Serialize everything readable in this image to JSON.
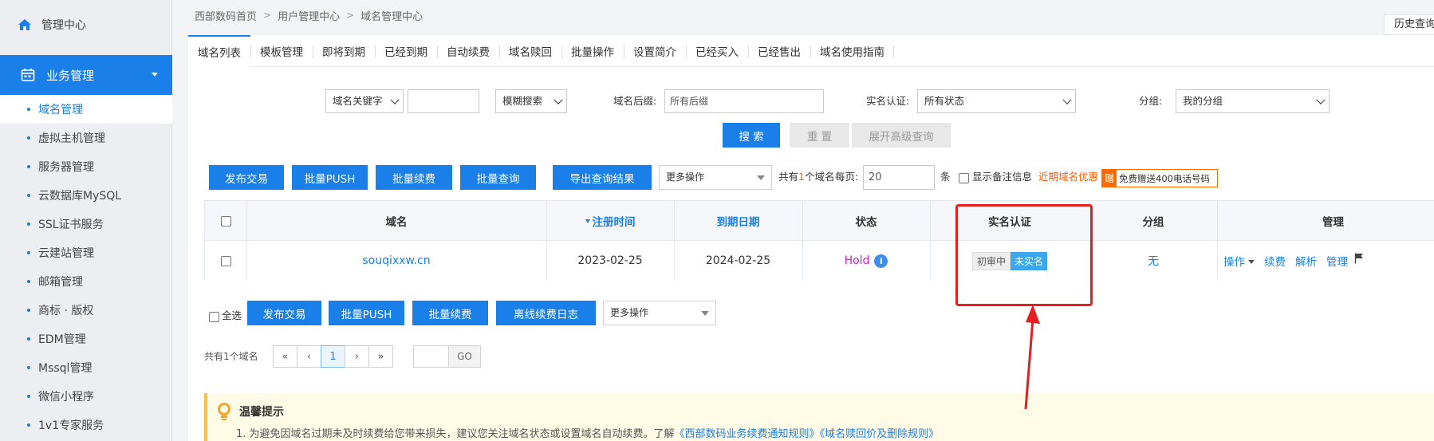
{
  "sidebar": {
    "top_item": "管理中心",
    "section": "业务管理",
    "items": [
      {
        "label": "域名管理",
        "active": true
      },
      {
        "label": "虚拟主机管理"
      },
      {
        "label": "服务器管理"
      },
      {
        "label": "云数据库MySQL"
      },
      {
        "label": "SSL证书服务"
      },
      {
        "label": "云建站管理"
      },
      {
        "label": "邮箱管理"
      },
      {
        "label": "商标 · 版权"
      },
      {
        "label": "EDM管理"
      },
      {
        "label": "Mssql管理"
      },
      {
        "label": "微信小程序"
      },
      {
        "label": "1v1专家服务"
      }
    ]
  },
  "breadcrumb": [
    "西部数码首页",
    "用户管理中心",
    "域名管理中心"
  ],
  "history_button": "历史查询",
  "tabs": [
    "域名列表",
    "模板管理",
    "即将到期",
    "已经到期",
    "自动续费",
    "域名赎回",
    "批量操作",
    "设置简介",
    "已经买入",
    "已经售出",
    "域名使用指南"
  ],
  "search": {
    "keyword_select": "域名关键字",
    "keyword_value": "",
    "match_select": "模糊搜索",
    "suffix_label": "域名后缀:",
    "suffix_value": "所有后缀",
    "realname_label": "实名认证:",
    "realname_value": "所有状态",
    "group_label": "分组:",
    "group_value": "我的分组",
    "search_btn": "搜 索",
    "reset_btn": "重 置",
    "advanced_btn": "展开高级查询"
  },
  "toolbar": {
    "publish": "发布交易",
    "batch_push": "批量PUSH",
    "batch_renew": "批量续费",
    "batch_query": "批量查询",
    "export": "导出查询结果",
    "more": "更多操作",
    "total_prefix": "共有",
    "total_count": "1",
    "total_suffix": "个域名",
    "per_page_label": "每页:",
    "per_page_value": "20",
    "per_page_unit": "条",
    "show_remark": "显示备注信息",
    "promo": "近期域名优惠",
    "gift_badge": "赠",
    "gift_text": "免费赠送400电话号码"
  },
  "table": {
    "headers": {
      "domain": "域名",
      "reg_time": "注册时间",
      "expire": "到期日期",
      "status": "状态",
      "realname": "实名认证",
      "group": "分组",
      "manage": "管理"
    },
    "rows": [
      {
        "domain": "souqixxw.cn",
        "reg_time": "2023-02-25",
        "expire": "2024-02-25",
        "status": "Hold",
        "realname_tag1": "初审中",
        "realname_tag2": "未实名",
        "group": "无",
        "action_op": "操作",
        "action_renew": "续费",
        "action_dns": "解析",
        "action_manage": "管理"
      }
    ]
  },
  "bottom_toolbar": {
    "select_all": "全选",
    "publish": "发布交易",
    "batch_push": "批量PUSH",
    "batch_renew": "批量续费",
    "offline_log": "离线续费日志",
    "more": "更多操作"
  },
  "pagination": {
    "total": "共有1个域名",
    "first": "«",
    "prev": "‹",
    "current": "1",
    "next": "›",
    "last": "»",
    "go": "GO"
  },
  "tip": {
    "title": "温馨提示",
    "line1_prefix": "1. 为避免因域名过期未及时续费给您带来损失，建议您关注域名状态或设置域名自动续费。了解",
    "link1": "《西部数码业务续费通知规则》",
    "link2": "《域名赎回价及删除规则》"
  },
  "colors": {
    "primary": "#1a7fe8",
    "status_hold": "#d21fd0",
    "promo": "#ff5a00",
    "annotation": "#e51f1f"
  }
}
